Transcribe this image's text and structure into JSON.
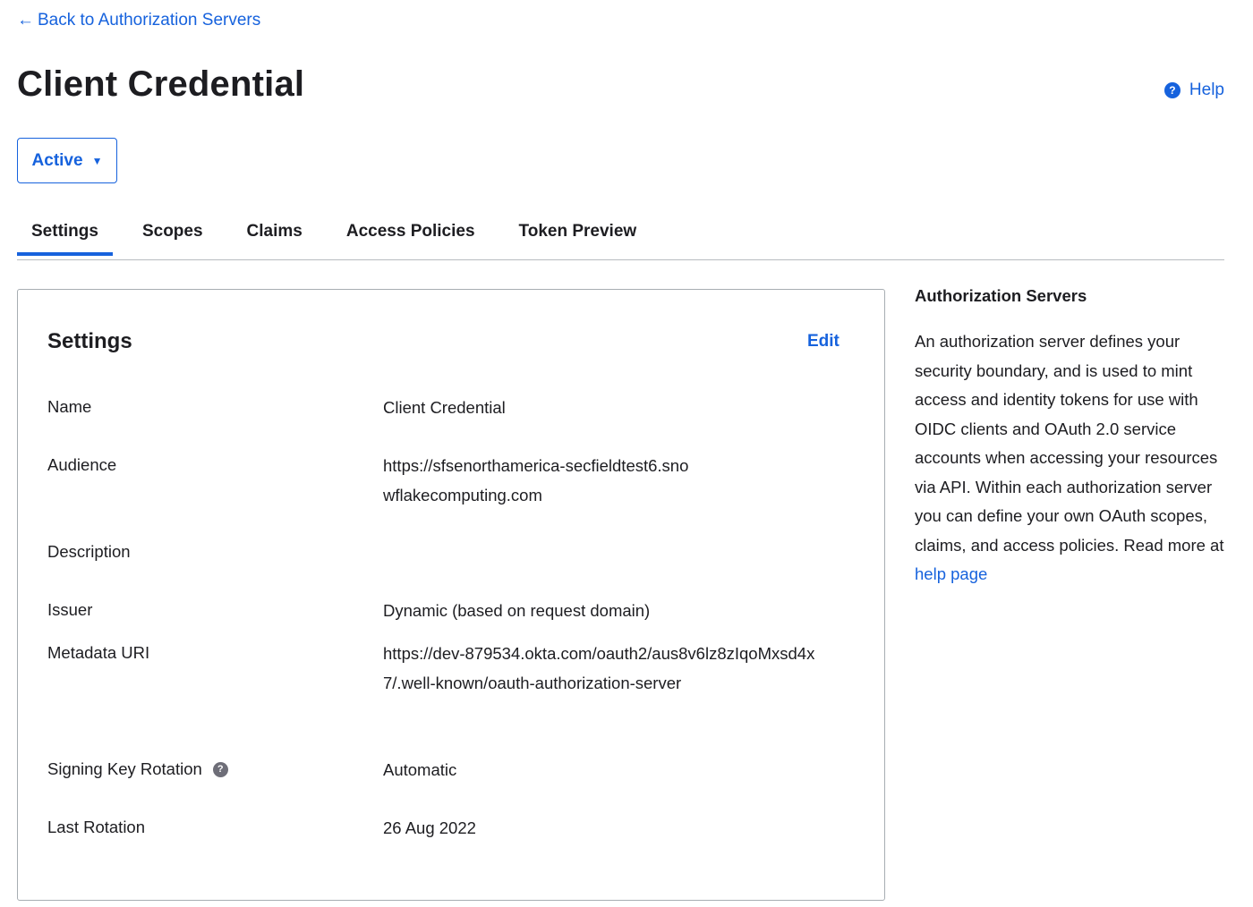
{
  "nav": {
    "back_arrow": "←",
    "back_label": "Back to Authorization Servers"
  },
  "header": {
    "title": "Client Credential",
    "help_label": "Help",
    "help_icon_glyph": "?"
  },
  "status": {
    "label": "Active",
    "caret": "▼"
  },
  "tabs": [
    {
      "label": "Settings"
    },
    {
      "label": "Scopes"
    },
    {
      "label": "Claims"
    },
    {
      "label": "Access Policies"
    },
    {
      "label": "Token Preview"
    }
  ],
  "settings": {
    "title": "Settings",
    "edit_label": "Edit",
    "rows": [
      {
        "label": "Name",
        "value": "Client Credential"
      },
      {
        "label": "Audience",
        "value": "https://sfsenorthamerica-secfieldtest6.snowflakecomputing.com"
      },
      {
        "label": "Description",
        "value": ""
      },
      {
        "label": "Issuer",
        "value": "Dynamic (based on request domain)"
      },
      {
        "label": "Metadata URI",
        "value": "https://dev-879534.okta.com/oauth2/aus8v6lz8zIqoMxsd4x7/.well-known/oauth-authorization-server"
      },
      {
        "label": "Signing Key Rotation",
        "value": "Automatic",
        "icon_glyph": "?"
      },
      {
        "label": "Last Rotation",
        "value": "26 Aug 2022"
      }
    ]
  },
  "aside": {
    "title": "Authorization Servers",
    "text": "An authorization server defines your security boundary, and is used to mint access and identity tokens for use with OIDC clients and OAuth 2.0 service accounts when accessing your resources via API. Within each authorization server you can define your own OAuth scopes, claims, and access policies. Read more at ",
    "link_label": "help page"
  },
  "colors": {
    "accent": "#1662dd",
    "text": "#1d1d21",
    "border": "#a7adb2"
  }
}
